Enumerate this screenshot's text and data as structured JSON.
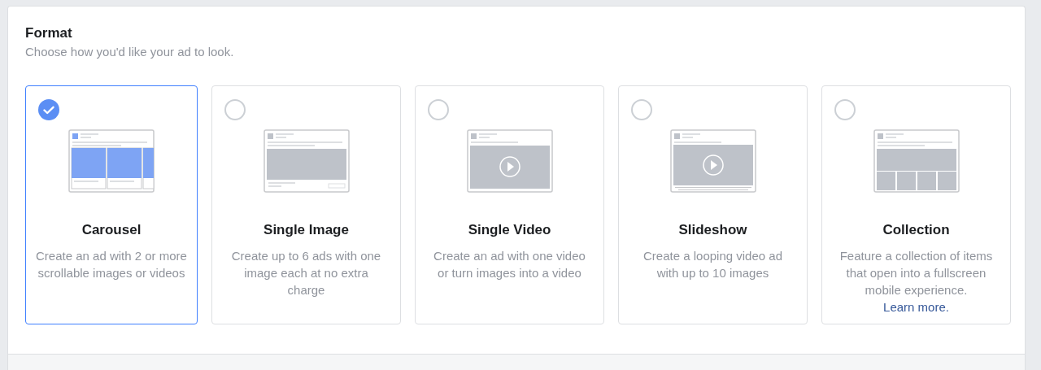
{
  "section": {
    "title": "Format",
    "subtitle": "Choose how you'd like your ad to look."
  },
  "formats": [
    {
      "kind": "carousel",
      "title": "Carousel",
      "description": "Create an ad with 2 or more scrollable images or videos",
      "selected": true
    },
    {
      "kind": "image",
      "title": "Single Image",
      "description": "Create up to 6 ads with one image each at no extra charge",
      "selected": false
    },
    {
      "kind": "video",
      "title": "Single Video",
      "description": "Create an ad with one video or turn images into a video",
      "selected": false
    },
    {
      "kind": "slideshow",
      "title": "Slideshow",
      "description": "Create a looping video ad with up to 10 images",
      "selected": false
    },
    {
      "kind": "collection",
      "title": "Collection",
      "description": "Feature a collection of items that open into a fullscreen mobile experience.",
      "link": "Learn more.",
      "selected": false
    }
  ]
}
